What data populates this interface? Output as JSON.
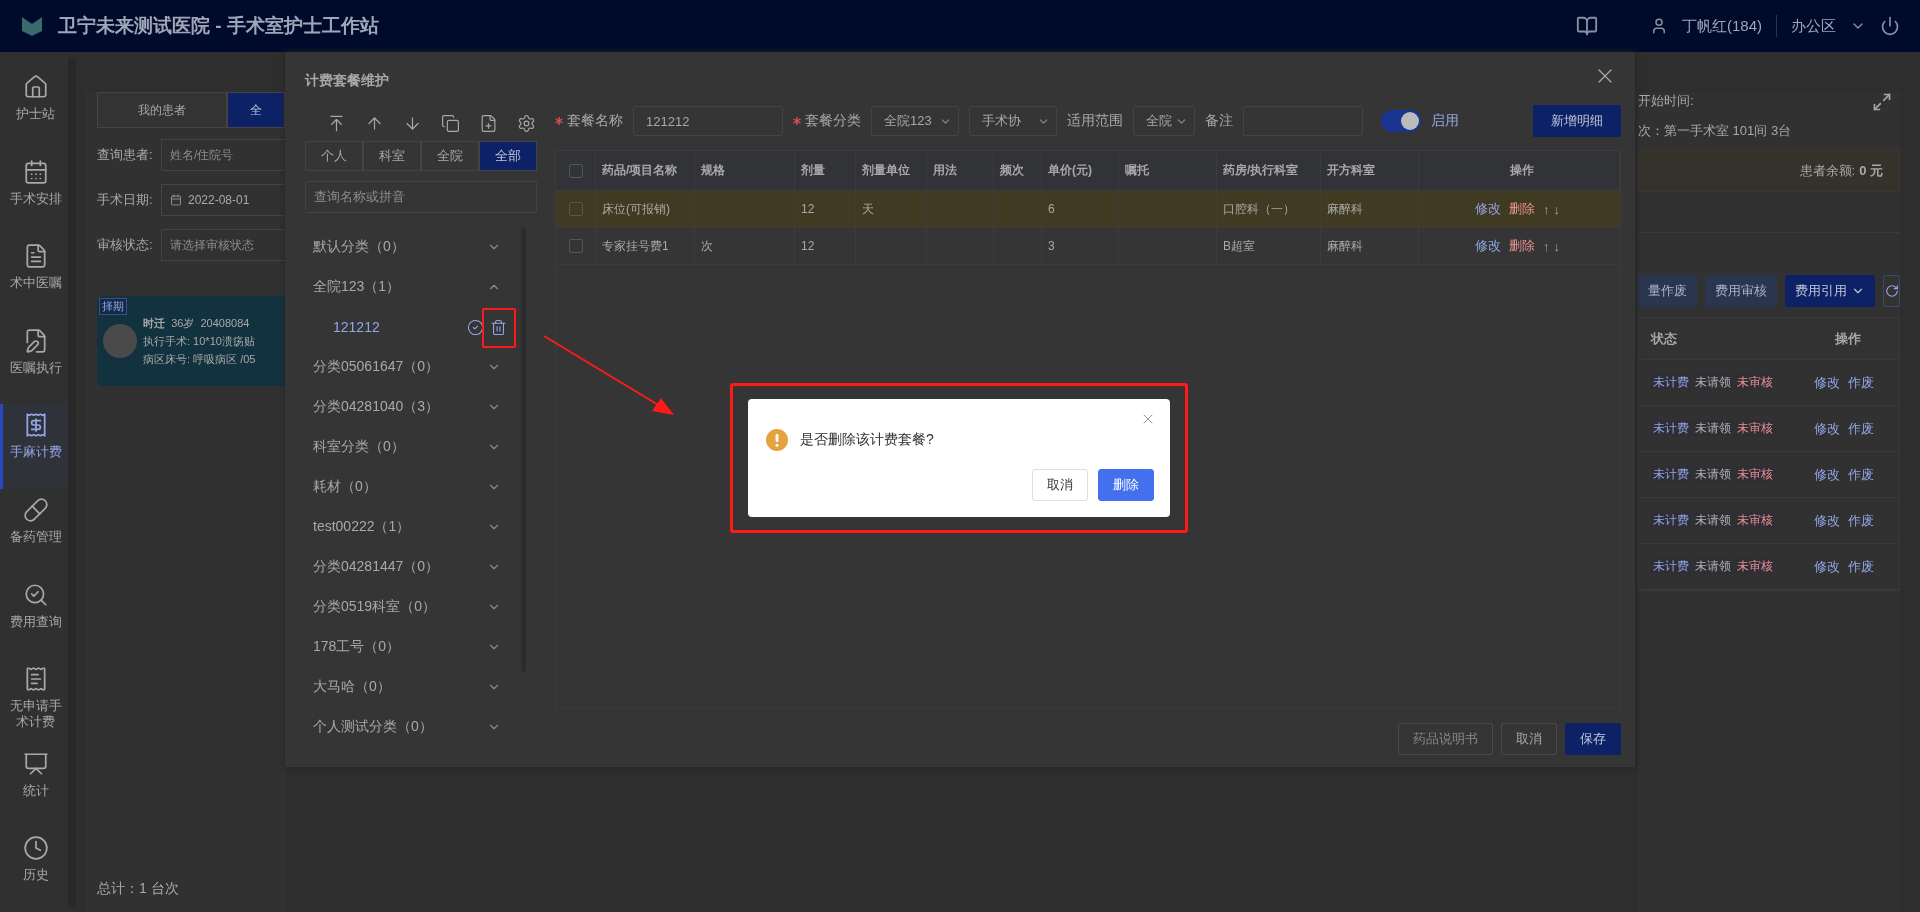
{
  "header": {
    "title": "卫宁未来测试医院 - 手术室护士工作站",
    "user": "丁帆红(184)",
    "area": "办公区"
  },
  "nav": [
    {
      "label": "护士站",
      "selected": false
    },
    {
      "label": "手术安排",
      "selected": false
    },
    {
      "label": "术中医嘱",
      "selected": false
    },
    {
      "label": "医嘱执行",
      "selected": false
    },
    {
      "label": "手麻计费",
      "selected": true
    },
    {
      "label": "备药管理",
      "selected": false
    },
    {
      "label": "费用查询",
      "selected": false
    },
    {
      "label": "无申请手术计费",
      "selected": false
    },
    {
      "label": "统计",
      "selected": false
    },
    {
      "label": "历史",
      "selected": false
    }
  ],
  "patient_panel": {
    "tabs": [
      {
        "label": "我的患者",
        "selected": false
      },
      {
        "label": "全",
        "selected": true
      }
    ],
    "fields": [
      {
        "label": "查询患者:",
        "kind": "input",
        "placeholder": "姓名/住院号"
      },
      {
        "label": "手术日期:",
        "kind": "date",
        "value": "2022-08-01"
      },
      {
        "label": "审核状态:",
        "kind": "select",
        "placeholder": "请选择审核状态"
      }
    ],
    "card": {
      "selected": true,
      "badge": "择期",
      "name": "时迁",
      "age": "36岁",
      "number": "20408084",
      "lines": [
        "执行手术: 10*10溃疡贴",
        "病区床号: 呼吸病区 /05"
      ]
    },
    "total": "总计：1 台次"
  },
  "detail_panel": {
    "start_label": "开始时间:",
    "room_label": "次：",
    "room": "第一手术室 101间 3台",
    "balance_label": "患者余额:",
    "balance": "0 元",
    "buttons": [
      {
        "label": "量作废",
        "kind": "muted"
      },
      {
        "label": "费用审核",
        "kind": "muted"
      },
      {
        "label": "费用引用",
        "kind": "dropdown"
      }
    ],
    "table": {
      "columns": [
        "状态",
        "操作"
      ],
      "rows": [
        {
          "tags": [
            {
              "label": "未计费",
              "color": "#8fa3e6"
            },
            {
              "label": "未请领",
              "color": "#b0b0b0"
            },
            {
              "label": "未审核",
              "color": "#e68f8f"
            }
          ],
          "actions": [
            "修改",
            "作废"
          ]
        },
        {
          "tags": [
            {
              "label": "未计费",
              "color": "#8fa3e6"
            },
            {
              "label": "未请领",
              "color": "#b0b0b0"
            },
            {
              "label": "未审核",
              "color": "#e68f8f"
            }
          ],
          "actions": [
            "修改",
            "作废"
          ]
        },
        {
          "tags": [
            {
              "label": "未计费",
              "color": "#8fa3e6"
            },
            {
              "label": "未请领",
              "color": "#b0b0b0"
            },
            {
              "label": "未审核",
              "color": "#e68f8f"
            }
          ],
          "actions": [
            "修改",
            "作废"
          ]
        },
        {
          "tags": [
            {
              "label": "未计费",
              "color": "#8fa3e6"
            },
            {
              "label": "未请领",
              "color": "#b0b0b0"
            },
            {
              "label": "未审核",
              "color": "#e68f8f"
            }
          ],
          "actions": [
            "修改",
            "作废"
          ]
        },
        {
          "tags": [
            {
              "label": "未计费",
              "color": "#8fa3e6"
            },
            {
              "label": "未请领",
              "color": "#b0b0b0"
            },
            {
              "label": "未审核",
              "color": "#e68f8f"
            }
          ],
          "actions": [
            "修改",
            "作废"
          ]
        }
      ]
    }
  },
  "drawer": {
    "title": "计费套餐维护",
    "filter_tabs": [
      {
        "label": "个人",
        "selected": false
      },
      {
        "label": "科室",
        "selected": false
      },
      {
        "label": "全院",
        "selected": false
      },
      {
        "label": "全部",
        "selected": true
      }
    ],
    "search_placeholder": "查询名称或拼音",
    "categories": [
      {
        "label": "默认分类（0）",
        "expanded": false
      },
      {
        "label": "全院123（1）",
        "expanded": true,
        "children": [
          {
            "label": "121212",
            "selected": true
          }
        ]
      },
      {
        "label": "分类05061647（0）",
        "expanded": false
      },
      {
        "label": "分类04281040（3）",
        "expanded": false
      },
      {
        "label": "科室分类（0）",
        "expanded": false
      },
      {
        "label": "耗材（0）",
        "expanded": false
      },
      {
        "label": "test00222（1）",
        "expanded": false
      },
      {
        "label": "分类04281447（0）",
        "expanded": false
      },
      {
        "label": "分类0519科室（0）",
        "expanded": false
      },
      {
        "label": "178工号（0）",
        "expanded": false
      },
      {
        "label": "大马哈（0）",
        "expanded": false
      },
      {
        "label": "个人测试分类（0）",
        "expanded": false
      }
    ],
    "form": {
      "fields": [
        {
          "label": "套餐名称",
          "required": true,
          "kind": "input",
          "value": "121212"
        },
        {
          "label": "套餐分类",
          "required": true,
          "kind": "select",
          "value": "全院123"
        },
        {
          "kind": "select",
          "value": "手术协"
        },
        {
          "label": "适用范围",
          "required": false,
          "kind": "select",
          "value": "全院"
        },
        {
          "label": "备注",
          "required": false,
          "kind": "input"
        }
      ],
      "toggle": {
        "label": "启用",
        "on": true
      },
      "add_button": "新增明细"
    },
    "table": {
      "header_checked": false,
      "columns": [
        "药品/项目名称",
        "规格",
        "剂量",
        "剂量单位",
        "用法",
        "频次",
        "单价(元)",
        "嘱托",
        "药房/执行科室",
        "开方科室",
        "操作"
      ],
      "rows": [
        {
          "checked": false,
          "highlighted": true,
          "name": "床位(可报销)",
          "dose": "12",
          "unit": "天",
          "price": "6",
          "pharmacy": "口腔科（一）",
          "dept": "麻醉科",
          "actions": [
            "修改",
            "删除",
            "↑",
            "↓"
          ]
        },
        {
          "checked": false,
          "highlighted": false,
          "name": "专家挂号费1",
          "spec": "次",
          "dose": "12",
          "price": "3",
          "pharmacy": "B超室",
          "dept": "麻醉科",
          "actions": [
            "修改",
            "删除",
            "↑",
            "↓"
          ]
        }
      ]
    },
    "footer_buttons": [
      {
        "label": "药品说明书",
        "kind": "default",
        "disabled": true
      },
      {
        "label": "取消",
        "kind": "default",
        "disabled": false
      },
      {
        "label": "保存",
        "kind": "primary",
        "disabled": false
      }
    ]
  },
  "confirm": {
    "message": "是否删除该计费套餐?",
    "buttons": [
      {
        "label": "取消",
        "kind": "default"
      },
      {
        "label": "删除",
        "kind": "primary"
      }
    ]
  }
}
